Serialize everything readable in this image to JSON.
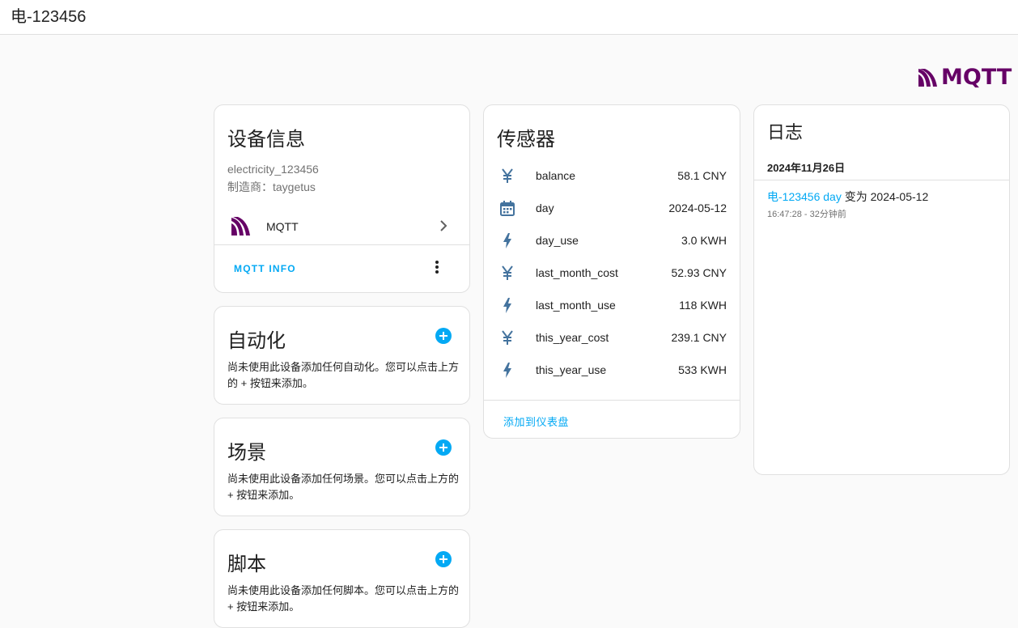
{
  "header": {
    "title": "电-123456"
  },
  "brand": {
    "logo_text": "MQTT",
    "color": "#660066"
  },
  "device_info": {
    "title": "设备信息",
    "model": "electricity_123456",
    "manufacturer": "制造商：taygetus",
    "integration": {
      "name": "MQTT",
      "icon": "mqtt-icon"
    },
    "action_label": "MQTT INFO"
  },
  "automation": {
    "title": "自动化",
    "description": "尚未使用此设备添加任何自动化。您可以点击上方的 + 按钮来添加。"
  },
  "scene": {
    "title": "场景",
    "description": "尚未使用此设备添加任何场景。您可以点击上方的 + 按钮来添加。"
  },
  "script": {
    "title": "脚本",
    "description": "尚未使用此设备添加任何脚本。您可以点击上方的 + 按钮来添加。"
  },
  "sensors": {
    "title": "传感器",
    "items": [
      {
        "icon": "yuan-icon",
        "name": "balance",
        "value": "58.1 CNY"
      },
      {
        "icon": "calendar-icon",
        "name": "day",
        "value": "2024-05-12"
      },
      {
        "icon": "lightning-icon",
        "name": "day_use",
        "value": "3.0 KWH"
      },
      {
        "icon": "yuan-icon",
        "name": "last_month_cost",
        "value": "52.93 CNY"
      },
      {
        "icon": "lightning-icon",
        "name": "last_month_use",
        "value": "118 KWH"
      },
      {
        "icon": "yuan-icon",
        "name": "this_year_cost",
        "value": "239.1 CNY"
      },
      {
        "icon": "lightning-icon",
        "name": "this_year_use",
        "value": "533 KWH"
      }
    ],
    "add_to_dashboard": "添加到仪表盘"
  },
  "logbook": {
    "title": "日志",
    "date": "2024年11月26日",
    "entry_link": "电-123456 day",
    "entry_text": " 变为 2024-05-12",
    "entry_time": "16:47:28 - 32分钟前"
  },
  "colors": {
    "accent": "#03a9f4",
    "icon": "#44739e",
    "mqtt": "#660066"
  }
}
